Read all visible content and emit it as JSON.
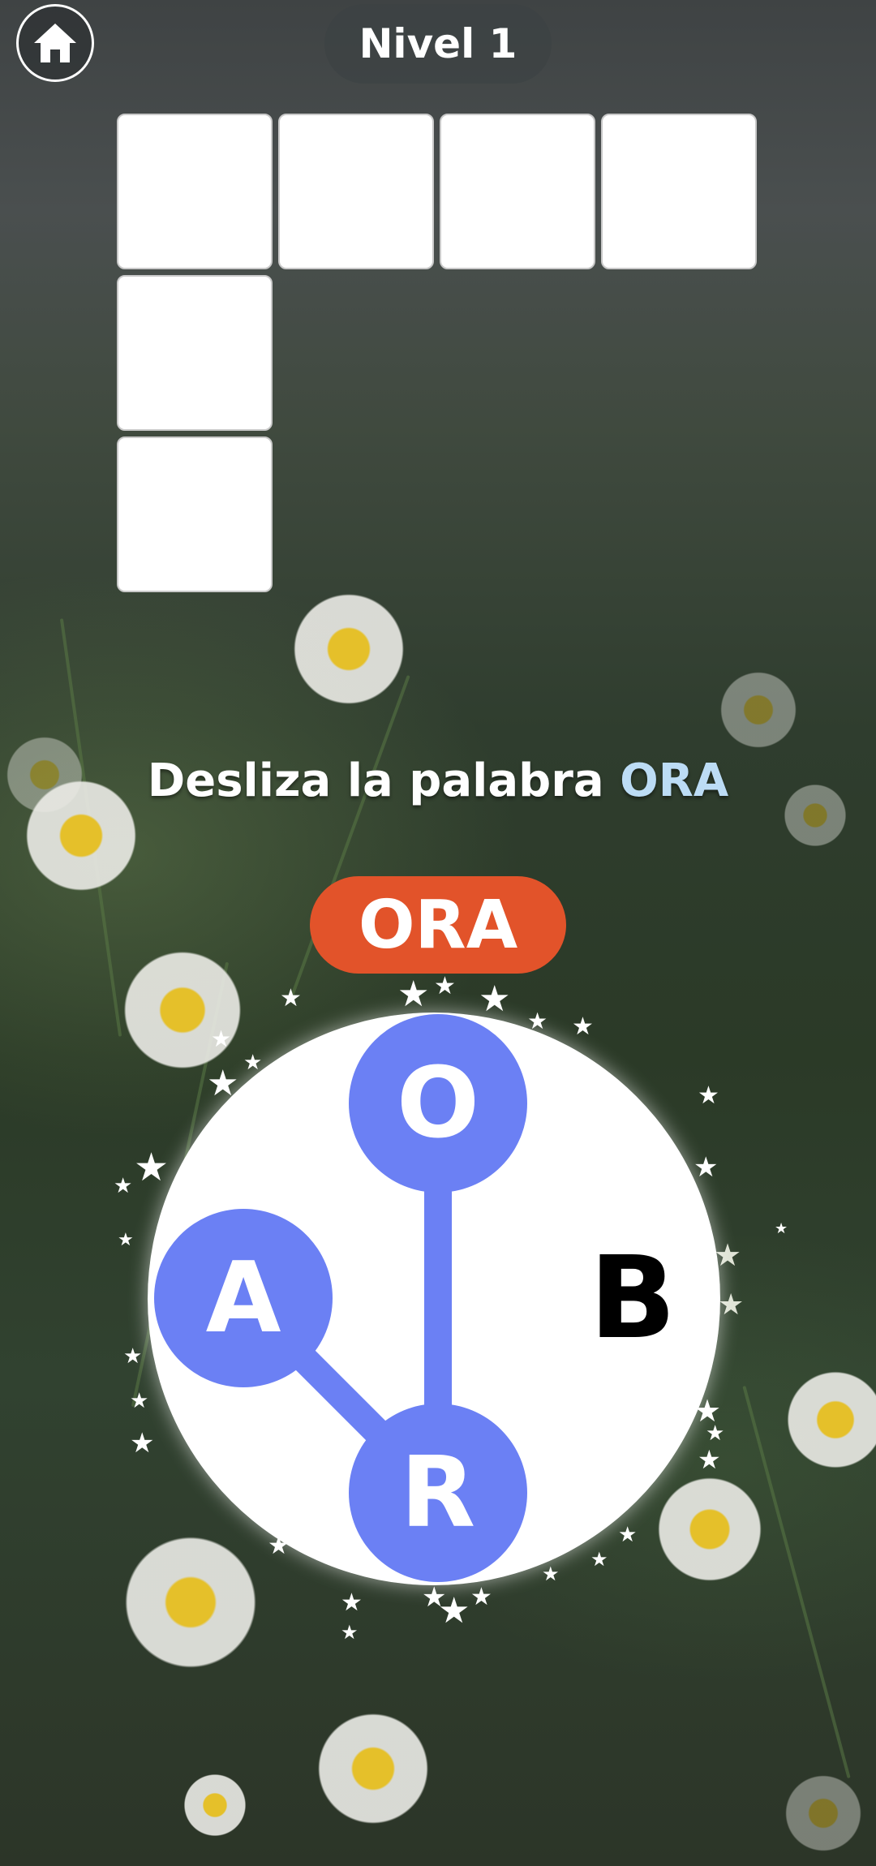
{
  "header": {
    "level_label": "Nivel 1"
  },
  "hint": {
    "prefix": "Desliza la palabra",
    "word": "ORA"
  },
  "current_word": "ORA",
  "letters": {
    "top": "O",
    "left": "A",
    "right": "B",
    "bottom": "R"
  },
  "colors": {
    "selected_letter": "#6b80f4",
    "current_word_bg": "#e2532a",
    "hint_word": "#bcdcf5"
  },
  "icons": {
    "home": "home-icon"
  }
}
